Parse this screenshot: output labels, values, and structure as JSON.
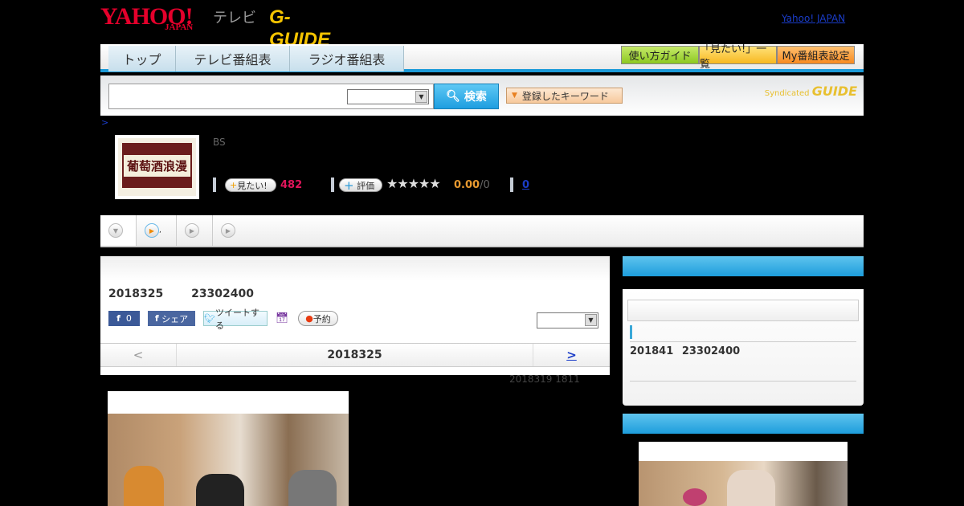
{
  "header": {
    "logo_yahoo": "YAHOO!",
    "logo_japan": "JAPAN",
    "logo_tv": "テレビ",
    "logo_gguide": "G-GUIDE",
    "yahoo_link": "Yahoo! JAPAN"
  },
  "nav": {
    "tabs": [
      "トップ",
      "テレビ番組表",
      "ラジオ番組表"
    ],
    "right_buttons": [
      "使い方ガイド",
      "「見たい!」一覧",
      "My番組表設定"
    ]
  },
  "search": {
    "input_value": "",
    "select_value": "",
    "button": "検索",
    "keyword_button": "登録したキーワード",
    "syndicated": "Syndicated",
    "syndicated_logo": "GUIDE"
  },
  "breadcrumb": ">",
  "program": {
    "thumb_title": "葡萄酒浪漫",
    "channel": "BS",
    "want_label": "見たい!",
    "want_count": "482",
    "rate_label": "評価",
    "stars": "★★★★★",
    "rating_value": 0,
    "score": "0.00",
    "score_count": "/0",
    "comment_count": "0"
  },
  "subnav": {
    "items": [
      "",
      ",",
      "",
      ""
    ]
  },
  "main": {
    "date": "2018325",
    "time": "23302400",
    "fb_count": "0",
    "fb_share": "シェア",
    "tweet": "ツイートする",
    "reserve": "予約",
    "sort_select": "",
    "prev": "<",
    "current_date": "2018325",
    "next": ">",
    "updated": "2018319  1811"
  },
  "sidebar": {
    "next_airing_date": "201841",
    "next_airing_time": "23302400"
  },
  "colors": {
    "accent": "#1d9ddc",
    "want": "#e0145a",
    "score": "#e89a30",
    "link": "#1a3cc8"
  }
}
